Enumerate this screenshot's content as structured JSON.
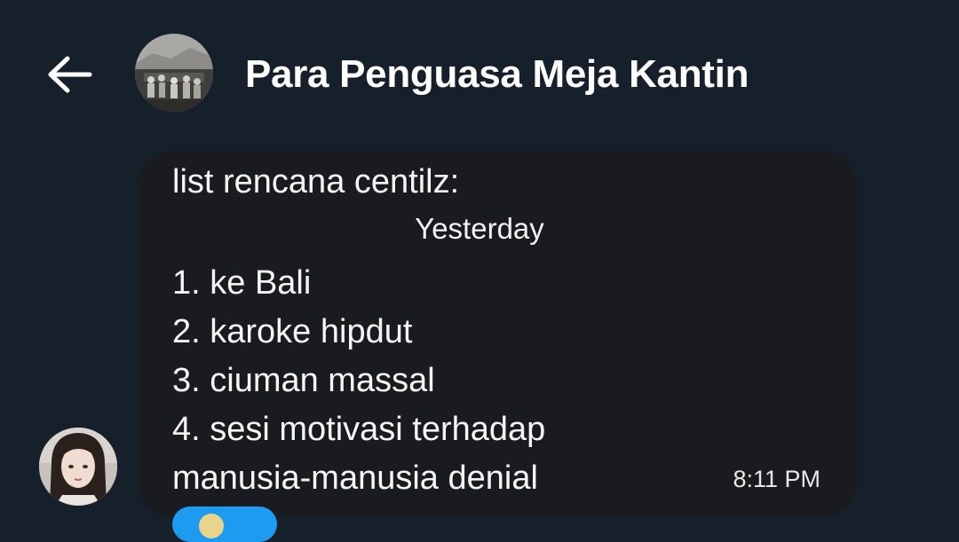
{
  "header": {
    "back_icon": "arrow-left-icon",
    "group_title": "Para Penguasa Meja Kantin"
  },
  "conversation": {
    "message": {
      "first_line": "list rencana centilz:",
      "date_divider": "Yesterday",
      "lines": [
        "1. ke Bali",
        "2. karoke hipdut",
        "3. ciuman massal",
        "4. sesi motivasi terhadap",
        "manusia-manusia denial"
      ],
      "time": "8:11 PM"
    }
  },
  "colors": {
    "background": "#15202b",
    "bubble": "#1a1b1f",
    "accent": "#1d9bf0",
    "text": "#ffffff"
  }
}
